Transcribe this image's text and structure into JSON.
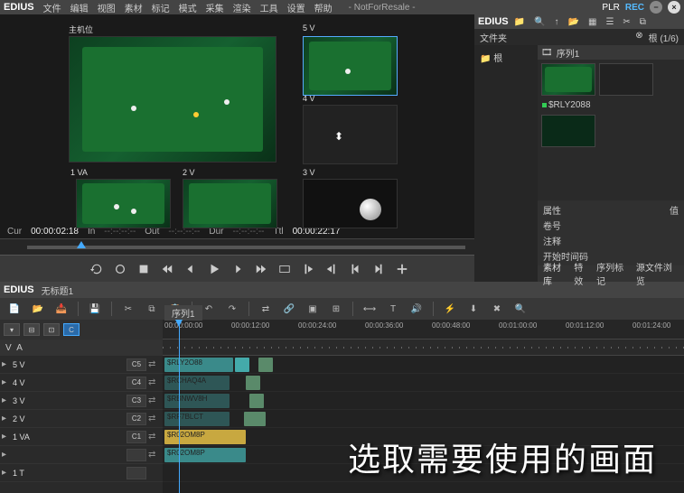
{
  "menubar": {
    "logo": "EDIUS",
    "items": [
      "文件",
      "编辑",
      "视图",
      "素材",
      "标记",
      "模式",
      "采集",
      "渲染",
      "工具",
      "设置",
      "帮助"
    ],
    "project": "- NotForResale -",
    "plr": "PLR",
    "rec": "REC"
  },
  "multicam": {
    "main_label": "主机位",
    "labels": {
      "5v": "5 V",
      "4v": "4 V",
      "1va": "1 VA",
      "2v": "2 V",
      "3v": "3 V"
    }
  },
  "timecodes": {
    "cur_lbl": "Cur",
    "cur": "00:00:02:18",
    "in_lbl": "In",
    "in": "--:--:--:--",
    "out_lbl": "Out",
    "out": "--:--:--:--",
    "dur_lbl": "Dur",
    "dur": "--:--:--:--",
    "ttl_lbl": "Ttl",
    "ttl": "00:00:22:17"
  },
  "bin": {
    "logo": "EDIUS",
    "folder_title": "文件夹",
    "root_label": "根",
    "page": "(1/6)",
    "tree_root": "根",
    "seq_label": "序列1",
    "clip_label": "$RLY2088",
    "props": {
      "p1": "属性",
      "v1": "值",
      "p2": "卷号",
      "p3": "注释",
      "p4": "开始时间码"
    },
    "tabs": [
      "素材库",
      "特效",
      "序列标记",
      "源文件浏览"
    ]
  },
  "timeline": {
    "logo": "EDIUS",
    "title": "无标题1",
    "seq_tab": "序列1",
    "ticks": [
      "00:00:00:00",
      "00:00:12:00",
      "00:00:24:00",
      "00:00:36:00",
      "00:00:48:00",
      "00:01:00:00",
      "00:01:12:00",
      "00:01:24:00"
    ],
    "tracks": [
      {
        "name": "5 V",
        "patch": "C5"
      },
      {
        "name": "4 V",
        "patch": "C4"
      },
      {
        "name": "3 V",
        "patch": "C3"
      },
      {
        "name": "2 V",
        "patch": "C2"
      },
      {
        "name": "1 VA",
        "patch": "C1"
      },
      {
        "name": "1 T",
        "patch": ""
      }
    ],
    "clips": {
      "c5": "$RLY2O88",
      "c4": "$RCHAQ4A",
      "c3": "$RBNWV8H",
      "c2": "$RF7BLCT",
      "c1a": "$R02OM8P",
      "c1b": "$R02OM8P"
    },
    "va_labels": {
      "v": "V",
      "a": "A"
    }
  },
  "overlay": "选取需要使用的画面"
}
